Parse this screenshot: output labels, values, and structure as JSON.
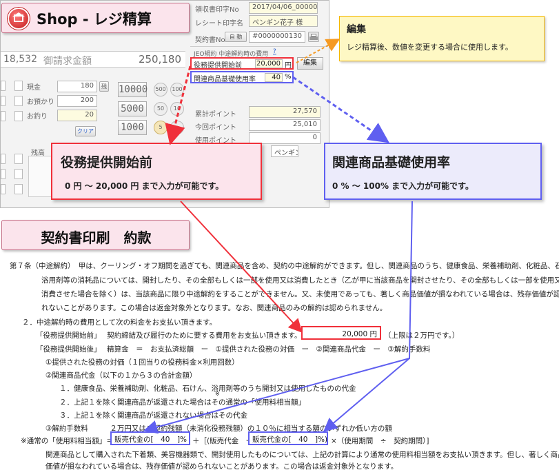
{
  "colors": {
    "red": "#f0303a",
    "blue": "#5f5ff0",
    "pink_bg": "#fce4ec",
    "yellow_bg": "#fef8c4",
    "orange": "#f59a23"
  },
  "header": {
    "logo_icon": "shop-logo-icon",
    "title": "Shop -  レジ精算"
  },
  "screen": {
    "receipt_no_label": "領収書印字No",
    "receipt_no_value": "2017/04/06_000002",
    "receipt_name_label": "レシート印字名",
    "receipt_name_value": "ペンギン花子 様",
    "contract_no_label": "契約書No",
    "contract_btn": "自 動",
    "contract_no_value": "#0000000130",
    "printer_icon": "printer-icon",
    "subtotal_value": "18,532",
    "billing_label": "御請求金額",
    "billing_value": "250,180",
    "cancel_fee_label": "JEO規約 中途解約時の費用",
    "help_link": "?",
    "service_fee_label": "役務提供開始前",
    "service_fee_value": "20,000",
    "service_fee_unit": "円",
    "edit_button": "編集",
    "product_rate_label": "関連商品基礎使用率",
    "product_rate_value": "40",
    "product_rate_unit": "%",
    "cash_label": "現金",
    "cash_value": "180",
    "deposit_label": "お預かり",
    "deposit_value": "200",
    "change_label": "お釣り",
    "change_value": "20",
    "small_btn": "残",
    "clear_button": "クリア",
    "bill_10000": "10000",
    "bill_5000": "5000",
    "bill_1000": "1000",
    "coin_500": "500",
    "coin_100": "100",
    "coin_50": "50",
    "coin_10": "10",
    "coin_5": "5",
    "points_total_label": "累計ポイント",
    "points_total_value": "27,570",
    "points_current_label": "今回ポイント",
    "points_current_value": "25,010",
    "points_use_label": "使用ポイント",
    "points_use_value": "0",
    "staff_value": "ペンギン",
    "remain_label": "残高"
  },
  "edit_callout": {
    "title": "編集",
    "text": "レジ精算後、数値を変更する場合に使用します。"
  },
  "service_callout": {
    "title": "役務提供開始前",
    "text": "0 円 ～  20,000 円 まで入力が可能です。"
  },
  "rate_callout": {
    "title": "関連商品基礎使用率",
    "text": "0 %  ～  100%  まで入力が可能です。"
  },
  "terms_banner": {
    "title": "契約書印刷　約款"
  },
  "document": {
    "l1": "第７条（中途解約）　甲は、クーリング・オフ期間を過ぎても、関連商品を含め、契約の中途解約ができます。但し、関連商品のうち、健康食品、栄養補助剤、化粧品、石けん、",
    "l2": "浴用剤等の消耗品については、開封したり、その全部もしくは一部を使用又は消費したとき（乙が甲に当該商品を開封させたり、その全部もしくは一部を使用又は",
    "l3": "消費させた場合を除く）は、当該商品に限り中途解約をすることができません。又、未使用であっても、著しく商品価値が損なわれている場合は、残存価値が認めら",
    "l4": "れないことがあります。この場合は返金対象外となります。なお、関連商品のみの解約は認められません。",
    "l5": "２．中途解約時の費用として次の料金をお支払い頂きます。",
    "l6a": "「役務提供開始前」　 契約締結及び履行のために要する費用をお支払い頂きます。",
    "l6_amount": "20,000 円",
    "l6b": "（上限は２万円です。）",
    "l7": "「役務提供開始後」　  精算金　＝　お支払済総額　ー　①提供された役務の対価　ー　②関連商品代金　ー　③解約手数料",
    "l8": "①提供された役務の対価（１回当りの役務料金×利用回数）",
    "l9": "②関連商品代金（以下の１から３の合計金額）",
    "l10": "１．健康食品、栄養補助剤、化粧品、石けん、浴用剤等のうち開封又は使用したものの代金",
    "l11": "２．上記１を除く関連商品が返還された場合はその通常の「使用料相当額」",
    "l12": "３．上記１を除く関連商品が返還されない場合はその代金",
    "l13": "③解約手数料　　　２万円又はご契約残額（未消化役務残額）の１０％に相当する額のいずれか低い方の額",
    "l14_prefix": "※通常の「使用料相当額」＝",
    "l14_box1": "販売代金の[　40　]%",
    "l14_mid": "＋［(販売代金　ー",
    "l14_box2": "販売代金の[　40　]%)",
    "l14_suffix": "×（使用期間　÷　契約期間）]",
    "l15": "関連商品として購入された下着類、美容機器類で、開封使用したものについては、上記の計算により通常の使用料相当額をお支払い頂きます。但し、著しく商品",
    "l16": "価値が損なわれている場合は、残存価値が認められないことがあります。この場合は返金対象外となります。",
    "note_mark": "※"
  }
}
